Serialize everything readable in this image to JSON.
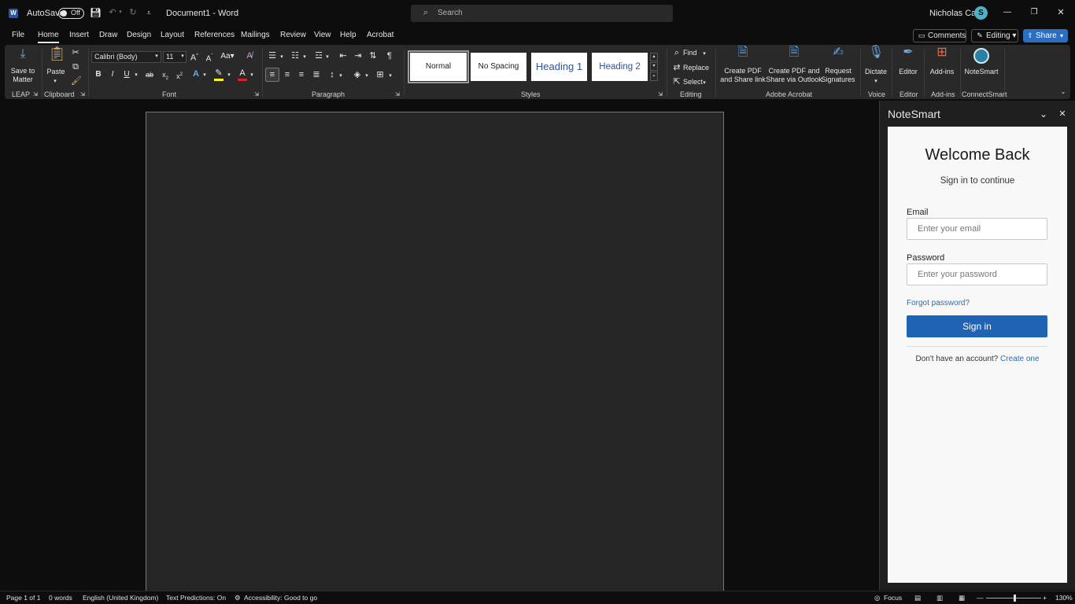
{
  "titlebar": {
    "autosave_label": "AutoSave",
    "autosave_state": "Off",
    "doc_title": "Document1  -  Word",
    "search_placeholder": "Search",
    "user_name": "Nicholas Carr",
    "minimize": "—",
    "restore": "❐",
    "close": "✕"
  },
  "tabs": [
    "File",
    "Home",
    "Insert",
    "Draw",
    "Design",
    "Layout",
    "References",
    "Mailings",
    "Review",
    "View",
    "Help",
    "Acrobat"
  ],
  "active_tab": "Home",
  "actions": {
    "comments": "Comments",
    "editing": "Editing",
    "share": "Share"
  },
  "ribbon": {
    "leap": {
      "button": "Save to Matter",
      "label": "LEAP"
    },
    "clipboard": {
      "paste": "Paste",
      "label": "Clipboard"
    },
    "font": {
      "name": "Calibri (Body)",
      "size": "11",
      "label": "Font"
    },
    "paragraph": {
      "label": "Paragraph"
    },
    "styles": {
      "items": [
        "Normal",
        "No Spacing",
        "Heading 1",
        "Heading 2"
      ],
      "label": "Styles"
    },
    "editing": {
      "find": "Find",
      "replace": "Replace",
      "select": "Select",
      "label": "Editing"
    },
    "acrobat": {
      "create_pdf": "Create PDF and Share link",
      "create_outlook": "Create PDF and Share via Outlook",
      "request": "Request Signatures",
      "label": "Adobe Acrobat"
    },
    "voice": {
      "dictate": "Dictate",
      "label": "Voice"
    },
    "editor": {
      "editor": "Editor",
      "label": "Editor"
    },
    "addins": {
      "addins": "Add-ins",
      "label": "Add-ins"
    },
    "connectsmart": {
      "notesmart": "NoteSmart",
      "label": "ConnectSmart"
    }
  },
  "pane": {
    "title": "NoteSmart",
    "welcome": "Welcome Back",
    "subtitle": "Sign in to continue",
    "email_label": "Email",
    "email_placeholder": "Enter your email",
    "password_label": "Password",
    "password_placeholder": "Enter your password",
    "forgot": "Forgot password?",
    "signin": "Sign in",
    "no_account": "Don't have an account?",
    "create": "Create one"
  },
  "status": {
    "page": "Page 1 of 1",
    "words": "0 words",
    "language": "English (United Kingdom)",
    "predictions": "Text Predictions: On",
    "accessibility": "Accessibility: Good to go",
    "focus": "Focus",
    "zoom": "130%"
  },
  "colors": {
    "accent": "#2b6ec2",
    "signin_button": "#1f63b5",
    "avatar": "#4fb0c9"
  }
}
